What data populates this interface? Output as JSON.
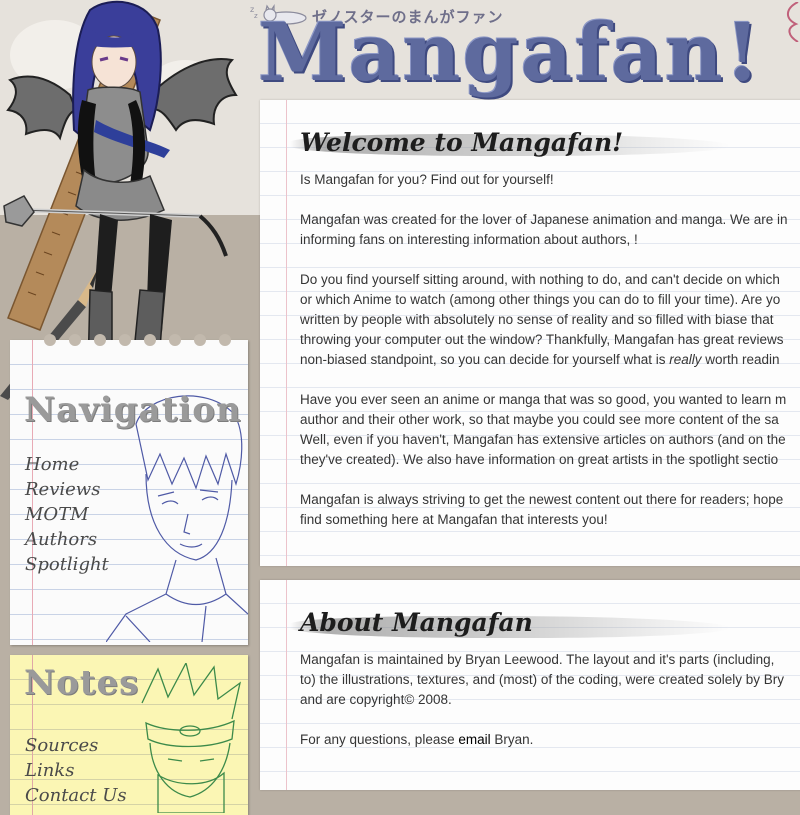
{
  "header": {
    "tagline": "ゼノスターのまんがファン",
    "logo": "Mangafan!"
  },
  "navigation": {
    "heading": "Navigation",
    "items": [
      "Home",
      "Reviews",
      "MOTM",
      "Authors",
      "Spotlight"
    ]
  },
  "notes": {
    "heading": "Notes",
    "items": [
      "Sources",
      "Links",
      "Contact Us"
    ]
  },
  "welcome": {
    "title": "Welcome to Mangafan!",
    "p1": "Is Mangafan for you? Find out for yourself!",
    "p2_l1": "Mangafan was created for the lover of Japanese animation and manga. We are in",
    "p2_l2": "informing fans on interesting information about authors, !",
    "p3_l1": "Do you find yourself sitting around, with nothing to do, and can't decide on which",
    "p3_l2": "or which Anime to watch (among other things you can do to fill your time). Are yo",
    "p3_l3": "written by people with absolutely no sense of reality and so filled with biase that",
    "p3_l4": "throwing your computer out the window? Thankfully, Mangafan has great reviews",
    "p3_l5_a": "non-biased standpoint, so you can decide for yourself what is ",
    "p3_l5_em": "really",
    "p3_l5_b": " worth readin",
    "p4_l1": "Have you ever seen an anime or manga that was so good, you wanted to learn m",
    "p4_l2": "author and their other work, so that maybe you could see more content of the sa",
    "p4_l3": "Well, even if you haven't, Mangafan has extensive articles on authors (and on the",
    "p4_l4": "they've created). We also have information on great artists in the spotlight sectio",
    "p5_l1": "Mangafan is always striving to get the newest content out there for readers; hope",
    "p5_l2": "find something here at Mangafan that interests you!"
  },
  "about": {
    "title": "About Mangafan",
    "p1_l1": "Mangafan is maintained by Bryan Leewood. The layout and it's parts (including,",
    "p1_l2": "to) the illustrations, textures, and (most) of the coding, were created solely by Bry",
    "p1_l3": "and are copyright© 2008.",
    "p2_a": "For any questions, please ",
    "p2_link": "email",
    "p2_b": " Bryan."
  },
  "colors": {
    "background": "#b9b0a4",
    "logo": "#5e6a9e",
    "notes_pad": "#fbf6b4"
  }
}
